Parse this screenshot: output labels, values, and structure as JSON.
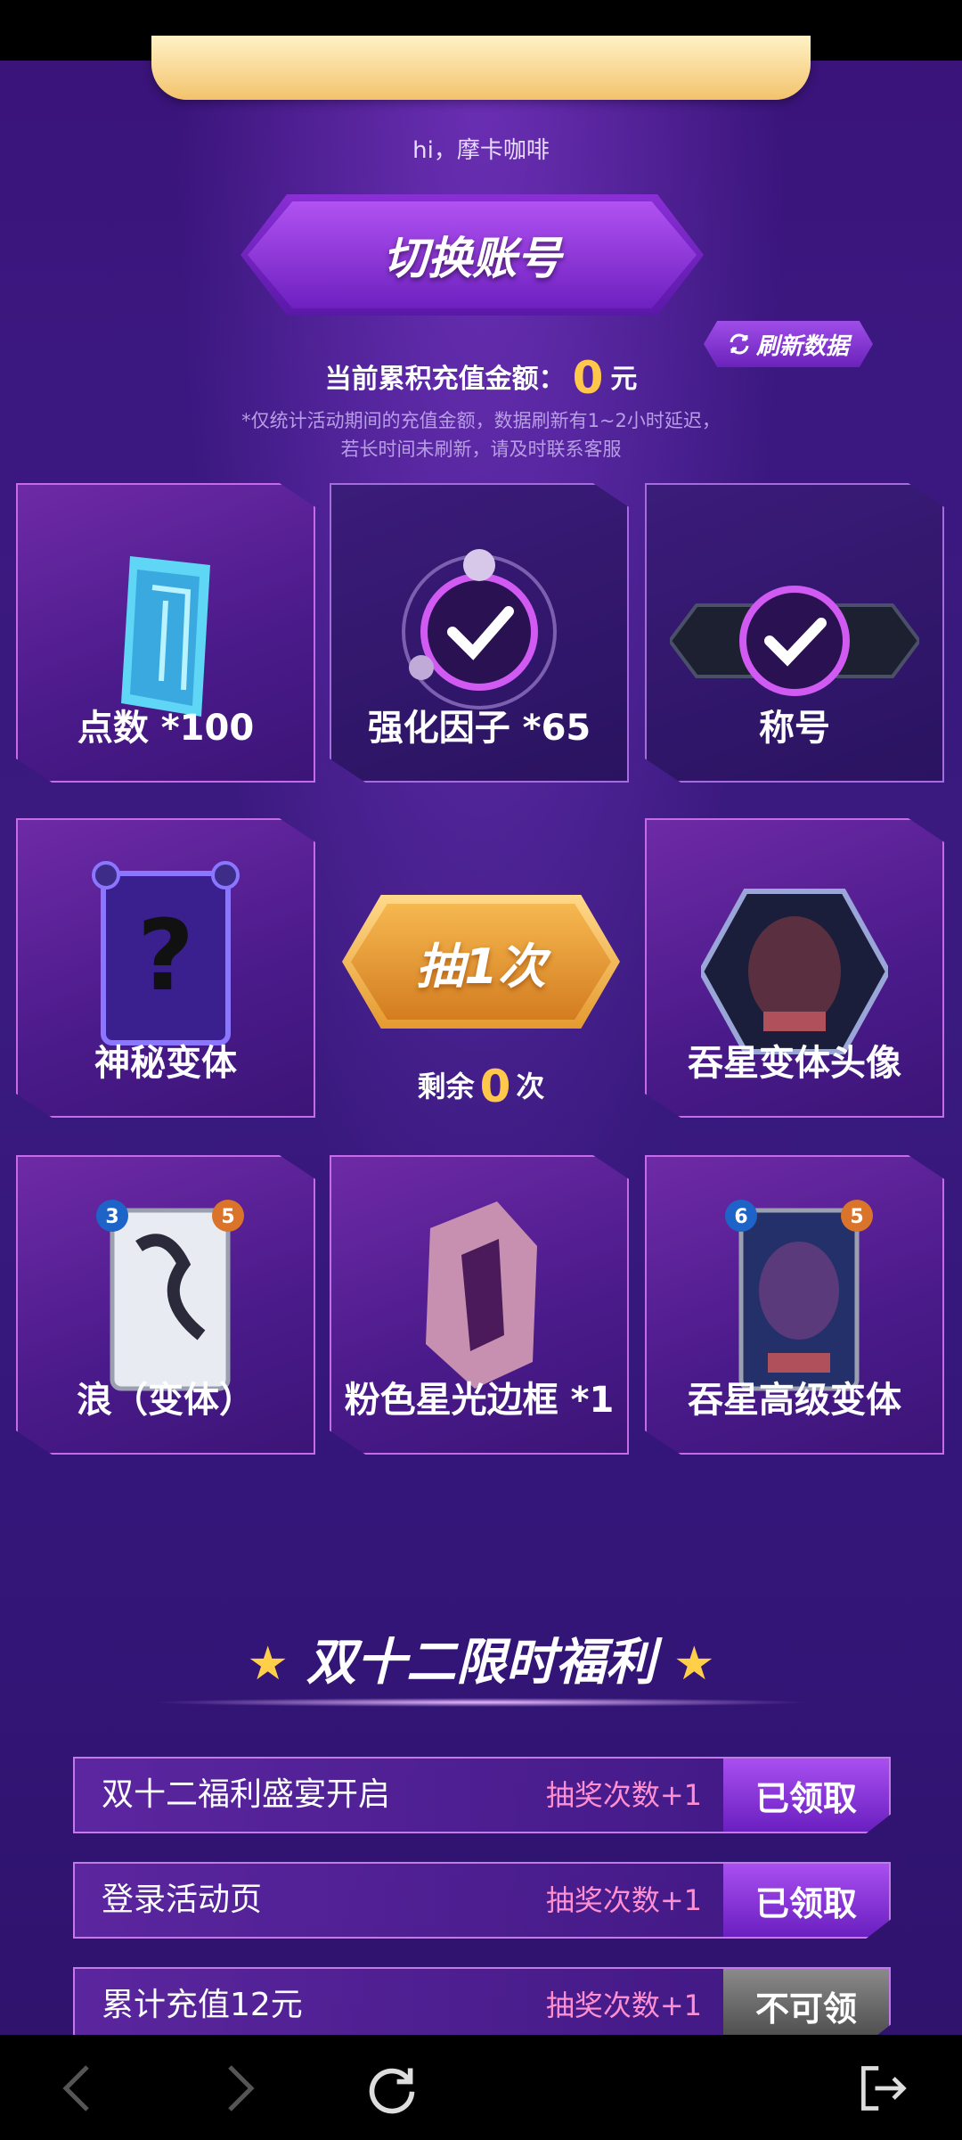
{
  "greeting": "hi，摩卡咖啡",
  "switch_account": "切换账号",
  "refresh_label": "刷新数据",
  "amount": {
    "label": "当前累积充值金额：",
    "value": "0",
    "unit": "元"
  },
  "notes": [
    "*仅统计活动期间的充值金额，数据刷新有1~2小时延迟，",
    "若长时间未刷新，请及时联系客服"
  ],
  "prizes": [
    {
      "label": "点数 *100",
      "icon": "blue-crystal-icon"
    },
    {
      "label": "强化因子 *65",
      "icon": "checkmark-orb-icon"
    },
    {
      "label": "称号",
      "icon": "checkmark-badge-icon"
    },
    {
      "label": "神秘变体",
      "icon": "mystery-card-icon"
    },
    {
      "label": "吞星变体头像",
      "icon": "galactus-avatar-icon"
    },
    {
      "label": "浪（变体）",
      "icon": "wave-card-icon"
    },
    {
      "label": "粉色星光边框 *1",
      "icon": "pink-frame-icon"
    },
    {
      "label": "吞星高级变体",
      "icon": "galactus-card-icon"
    }
  ],
  "card_stats": {
    "wave": {
      "cost": "3",
      "power": "5"
    },
    "galactus": {
      "cost": "6",
      "power": "5"
    }
  },
  "draw": {
    "label": "抽1次",
    "remain_prefix": "剩余",
    "remain_value": "0",
    "remain_suffix": "次"
  },
  "section_title": "双十二限时福利",
  "tasks": [
    {
      "name": "双十二福利盛宴开启",
      "reward": "抽奖次数+1",
      "button": "已领取",
      "state": "claimed"
    },
    {
      "name": "登录活动页",
      "reward": "抽奖次数+1",
      "button": "已领取",
      "state": "claimed"
    },
    {
      "name": "累计充值12元",
      "reward": "抽奖次数+1",
      "button": "不可领",
      "state": "disabled"
    }
  ],
  "colors": {
    "accent_gold": "#ffc84a",
    "reward_pink": "#ff8fd0",
    "purple": "#6a1fc0"
  }
}
